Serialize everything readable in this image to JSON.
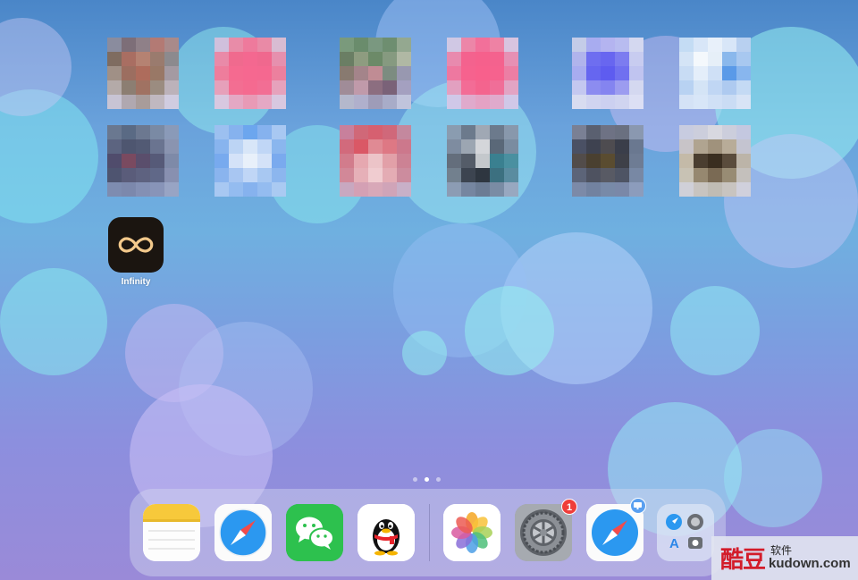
{
  "home_screen": {
    "grid_apps": [
      {
        "name": "blurred-app-1",
        "colors": [
          "#8a8c9e",
          "#7d6e78",
          "#8f8088",
          "#b37a74",
          "#a98a8a",
          "#7f6c60",
          "#a96e62",
          "#b58272",
          "#9a7b6e",
          "#8c8a8e",
          "#a09086",
          "#9c6e60",
          "#ae6c5c",
          "#997866",
          "#a49aa2",
          "#b4aaa8",
          "#8c7e72",
          "#a07262",
          "#9b8c80",
          "#bcb2ba",
          "#c8c4d4",
          "#b0a8b0",
          "#a89c9a",
          "#c0b8c0",
          "#d0cce0"
        ]
      },
      {
        "name": "blurred-app-2",
        "colors": [
          "#d0c0dc",
          "#e88ca8",
          "#ee7a9c",
          "#e98aa6",
          "#d8bcd2",
          "#e98aa8",
          "#f06a8e",
          "#f46890",
          "#f0688e",
          "#e690ae",
          "#ee7d9c",
          "#f56a90",
          "#f66890",
          "#f56890",
          "#ec809e",
          "#e6a0ba",
          "#f36e92",
          "#f56a90",
          "#f26e94",
          "#e6a2bc",
          "#d8c8e0",
          "#e4a8c4",
          "#e89ab6",
          "#e4a8c4",
          "#d8c8e0"
        ]
      },
      {
        "name": "blurred-app-3",
        "colors": [
          "#7a9a7c",
          "#6a8c6c",
          "#7a9880",
          "#6e8e70",
          "#94a890",
          "#6a7e64",
          "#8e9c80",
          "#6c8a68",
          "#869a80",
          "#b0b8a4",
          "#887a70",
          "#a4848a",
          "#c08c94",
          "#7c8c80",
          "#9898b0",
          "#a08c98",
          "#c09aaa",
          "#8c6e80",
          "#7a6278",
          "#a4a0c0",
          "#b4b8cc",
          "#b0b0cc",
          "#9e9cb8",
          "#a8acc8",
          "#c0c4dc"
        ]
      },
      {
        "name": "blurred-app-4",
        "colors": [
          "#d0c8e4",
          "#ec86a8",
          "#f2709a",
          "#ee82a4",
          "#d8c4e0",
          "#e88aae",
          "#f4628e",
          "#f6608c",
          "#f4628e",
          "#e690b4",
          "#ee78a0",
          "#f6628e",
          "#f8608c",
          "#f6628e",
          "#ec7ea4",
          "#e2a0c0",
          "#f36c96",
          "#f4648e",
          "#f06e98",
          "#e2a4c4",
          "#d0c8e8",
          "#e0aacc",
          "#e4a2c4",
          "#e0aacc",
          "#d0c8e8"
        ]
      },
      {
        "name": "blurred-app-5",
        "colors": [
          "#c4cce8",
          "#a8acf0",
          "#b4b4f0",
          "#b8bcf0",
          "#d4d8f0",
          "#b0b4ec",
          "#6e6ef0",
          "#6866f0",
          "#7c7cf0",
          "#c8ccf0",
          "#a8acf0",
          "#6666f0",
          "#5e5cf0",
          "#7070f0",
          "#c0c4f0",
          "#c4c8f0",
          "#8c8cf0",
          "#8484f0",
          "#9c9cf0",
          "#d4d8f0",
          "#d8dcf0",
          "#d0d4f0",
          "#ccd0f0",
          "#d0d4f0",
          "#dcdff4"
        ]
      },
      {
        "name": "blurred-app-6",
        "colors": [
          "#c4dcf4",
          "#d8e6f8",
          "#e8f0fa",
          "#d8e6f8",
          "#b8d0f0",
          "#d4e4f6",
          "#f4f8fc",
          "#e6eff8",
          "#8ab8ec",
          "#a8c8f0",
          "#c8dcf4",
          "#e4eefa",
          "#cfe0f6",
          "#5a9ae8",
          "#88b6ee",
          "#b8d2f2",
          "#d4e4f6",
          "#c0d6f4",
          "#aecaf0",
          "#c4daf4",
          "#d4e2f6",
          "#d8e6f8",
          "#d0e0f6",
          "#cadcf4",
          "#d8e4f6"
        ]
      },
      {
        "name": "blurred-app-7",
        "colors": [
          "#6a7890",
          "#5a6a84",
          "#6c7890",
          "#7a8aa4",
          "#8a9ab8",
          "#5c6480",
          "#4e5670",
          "#525a74",
          "#6a7490",
          "#8a94b0",
          "#504c6c",
          "#7a4a60",
          "#5a4e6c",
          "#565a78",
          "#7e8aa8",
          "#4e5470",
          "#5a5c7a",
          "#5e6280",
          "#606888",
          "#8890b0",
          "#7e8cb0",
          "#7c88ac",
          "#8490b4",
          "#8894b8",
          "#98a4c4"
        ]
      },
      {
        "name": "blurred-app-8",
        "colors": [
          "#9cc0f0",
          "#86b2ee",
          "#6ca6ee",
          "#86b2ee",
          "#a8c8f2",
          "#88b4ee",
          "#bcd4f4",
          "#d8e6f8",
          "#c0d6f6",
          "#8ab6ee",
          "#78aaee",
          "#d4e2f8",
          "#e8f0fa",
          "#d4e2f8",
          "#7aaaee",
          "#8ab4ee",
          "#a8c6f2",
          "#c0d6f6",
          "#a8c8f2",
          "#8cb6ee",
          "#a8c8f2",
          "#94bcf0",
          "#86b2ee",
          "#94bcf0",
          "#aacaf2"
        ]
      },
      {
        "name": "blurred-app-9",
        "colors": [
          "#c8809c",
          "#d06878",
          "#d66070",
          "#d0687a",
          "#c4889e",
          "#d26a7c",
          "#da5866",
          "#e08a94",
          "#de7884",
          "#cc788c",
          "#d27c8c",
          "#e6a8b0",
          "#ecc4c8",
          "#e2a0a8",
          "#cc8294",
          "#d28898",
          "#e6b0b8",
          "#f0ccd0",
          "#e4acb4",
          "#cc8c9e",
          "#c8a8c0",
          "#d4a0b4",
          "#d8a8b8",
          "#d0a4b8",
          "#c8b0c8"
        ]
      },
      {
        "name": "blurred-app-10",
        "colors": [
          "#8a9cb0",
          "#6c7a8c",
          "#a0a8b4",
          "#6c7a8c",
          "#8898ac",
          "#7e8ca0",
          "#9ca6b2",
          "#d4d6da",
          "#5a6878",
          "#7a8ca0",
          "#646e7c",
          "#545c68",
          "#c4c8cc",
          "#3a8090",
          "#4a90a0",
          "#72808e",
          "#3c4450",
          "#2e3640",
          "#3c7080",
          "#5a8ca0",
          "#8c9cb4",
          "#7686a0",
          "#6c7c94",
          "#7a8ca4",
          "#98a8c0"
        ]
      },
      {
        "name": "blurred-app-11",
        "colors": [
          "#7a8094",
          "#5a6070",
          "#6e7284",
          "#6a7080",
          "#8a98b0",
          "#4a5064",
          "#3e4250",
          "#4e4c50",
          "#3a3e4a",
          "#6a7890",
          "#524c4a",
          "#4a4030",
          "#5a4c30",
          "#3e4048",
          "#6e7c94",
          "#5c6478",
          "#4e5260",
          "#585a64",
          "#4e5464",
          "#7888a4",
          "#7c8aa8",
          "#7282a0",
          "#788aa8",
          "#7a88a8",
          "#8c9cbc"
        ]
      },
      {
        "name": "blurred-app-12",
        "colors": [
          "#c8cce0",
          "#cccedc",
          "#d8d8e0",
          "#cccedc",
          "#c4c8e0",
          "#c8c4c8",
          "#b0a490",
          "#a0927c",
          "#b8ac98",
          "#c4c4d0",
          "#c4baa8",
          "#4a3e30",
          "#3a2e20",
          "#5a4c3c",
          "#bcb4a8",
          "#c8c2b4",
          "#968870",
          "#7a6a54",
          "#988c74",
          "#c4c0bc",
          "#d0d0d8",
          "#c8c4c0",
          "#c0bcb4",
          "#c8c4c0",
          "#d0d0dc"
        ]
      }
    ],
    "infinity_app": {
      "label": "Infinity",
      "accent": "#f3c98b"
    },
    "page_dots": {
      "count": 3,
      "active_index": 1
    }
  },
  "dock": {
    "apps": [
      {
        "name": "notes",
        "icon": "notes-icon"
      },
      {
        "name": "safari",
        "icon": "safari-icon"
      },
      {
        "name": "wechat",
        "icon": "wechat-icon"
      },
      {
        "name": "qq",
        "icon": "qq-penguin-icon"
      },
      {
        "name": "photos",
        "icon": "photos-icon"
      },
      {
        "name": "settings",
        "icon": "settings-gear-icon",
        "badge": "1"
      },
      {
        "name": "safari-recent",
        "icon": "safari-icon"
      },
      {
        "name": "app-library",
        "icon": "app-library-icon"
      }
    ],
    "badge_color": "#ef3e3a"
  },
  "watermark": {
    "brand": "酷豆",
    "sub": "软件",
    "domain": "kudown.com"
  }
}
